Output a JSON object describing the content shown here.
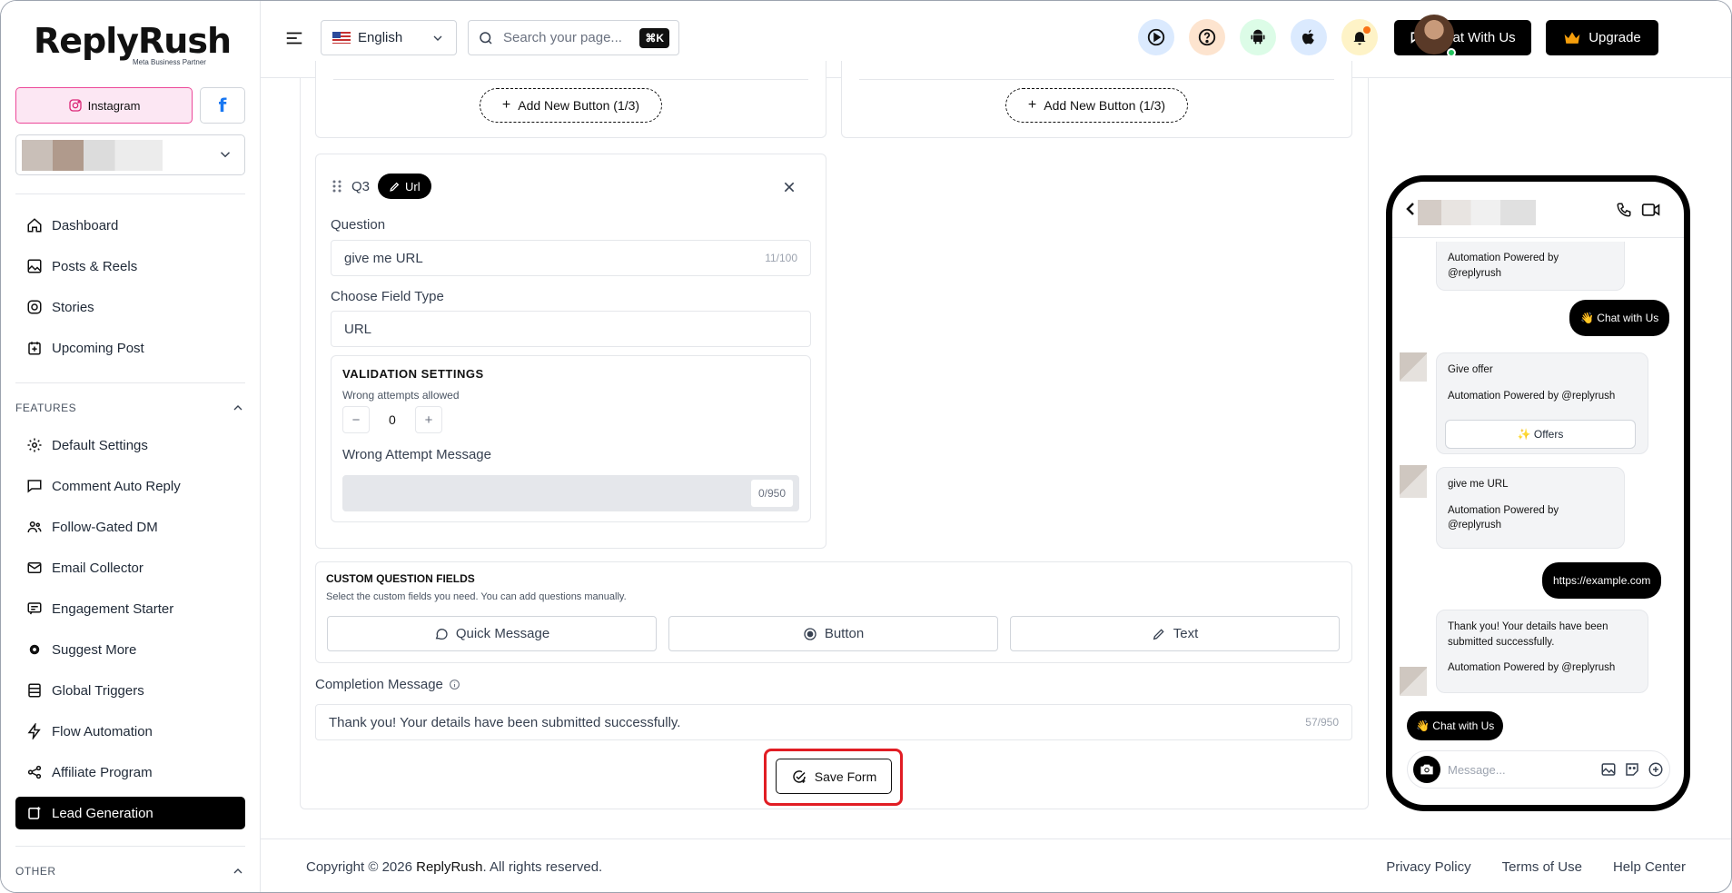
{
  "brand": {
    "name": "ReplyRush",
    "partner": "Meta Business Partner"
  },
  "platform_tabs": {
    "instagram": "Instagram",
    "facebook": "f"
  },
  "sidebar": {
    "items": [
      {
        "label": "Dashboard",
        "icon": "home-icon"
      },
      {
        "label": "Posts & Reels",
        "icon": "image-icon"
      },
      {
        "label": "Stories",
        "icon": "instagram-icon"
      },
      {
        "label": "Upcoming Post",
        "icon": "calendar-plus-icon"
      }
    ],
    "features_title": "FEATURES",
    "features": [
      {
        "label": "Default Settings",
        "icon": "gear-icon"
      },
      {
        "label": "Comment Auto Reply",
        "icon": "comment-icon"
      },
      {
        "label": "Follow-Gated DM",
        "icon": "users-icon"
      },
      {
        "label": "Email Collector",
        "icon": "mail-icon"
      },
      {
        "label": "Engagement Starter",
        "icon": "chat-list-icon"
      },
      {
        "label": "Suggest More",
        "icon": "gear-star-icon"
      },
      {
        "label": "Global Triggers",
        "icon": "list-icon"
      },
      {
        "label": "Flow Automation",
        "icon": "bolt-icon"
      },
      {
        "label": "Affiliate Program",
        "icon": "share-icon"
      },
      {
        "label": "Lead Generation",
        "icon": "lead-icon",
        "active": true
      }
    ],
    "other_title": "OTHER"
  },
  "topbar": {
    "language": "English",
    "search_placeholder": "Search your page...",
    "search_shortcut": "⌘K",
    "chat_button": "Chat With Us",
    "upgrade_button": "Upgrade"
  },
  "form": {
    "add_button_left": "Add New Button (1/3)",
    "add_button_right": "Add New Button (1/3)",
    "question_number": "Q3",
    "question_type_pill": "Url",
    "question_label": "Question",
    "question_value": "give me URL",
    "question_counter": "11/100",
    "field_type_label": "Choose Field Type",
    "field_type_value": "URL",
    "validation_title": "VALIDATION SETTINGS",
    "wrong_attempts_label": "Wrong attempts allowed",
    "wrong_attempts_value": "0",
    "stepper_minus": "−",
    "stepper_plus": "+",
    "wrong_msg_label": "Wrong Attempt Message",
    "wrong_msg_counter": "0/950",
    "custom_title": "CUSTOM QUESTION FIELDS",
    "custom_desc": "Select the custom fields you need. You can add questions manually.",
    "quick_message": "Quick Message",
    "button": "Button",
    "text": "Text",
    "completion_label": "Completion Message",
    "completion_value": "Thank you! Your details have been submitted successfully.",
    "completion_counter": "57/950",
    "save_button": "Save Form"
  },
  "footer": {
    "copyright_prefix": "Copyright © 2026 ",
    "copyright_brand": "ReplyRush",
    "copyright_suffix": ". All rights reserved.",
    "privacy": "Privacy Policy",
    "terms": "Terms of Use",
    "help": "Help Center"
  },
  "preview": {
    "msg1_line1": "Automation Powered by",
    "msg1_line2": "@replyrush",
    "chat_with_us_1": "👋 Chat with Us",
    "give_offer": "Give offer",
    "powered_full_1": "Automation Powered by @replyrush",
    "offers_button": "✨ Offers",
    "give_url": "give me URL",
    "msg3_line1": "Automation Powered by",
    "msg3_line2": "@replyrush",
    "url_reply": "https://example.com",
    "thanks_line1": "Thank you! Your details have been",
    "thanks_line2": "submitted successfully.",
    "powered_full_2": "Automation Powered by @replyrush",
    "chat_with_us_2": "👋 Chat with Us",
    "message_placeholder": "Message..."
  }
}
